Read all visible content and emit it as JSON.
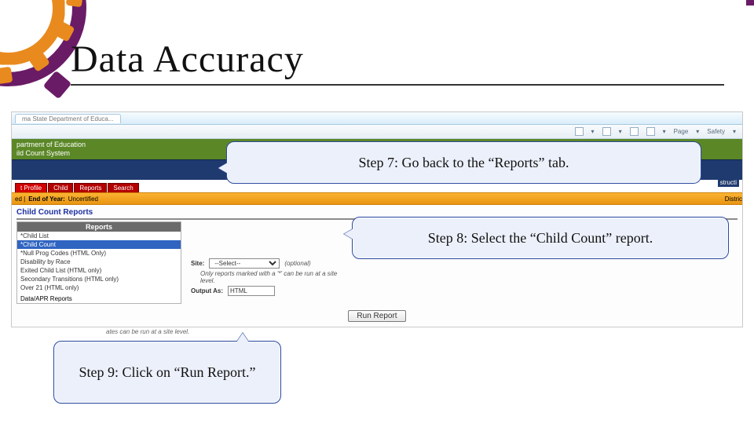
{
  "slide": {
    "title": "Data Accuracy"
  },
  "callouts": {
    "step7": "Step 7: Go back to the “Reports” tab.",
    "step8": "Step 8: Select the “Child Count” report.",
    "step9": "Step 9: Click on “Run Report.”"
  },
  "browser": {
    "tab_title": "ma State Department of Educa...",
    "toolbar": {
      "page": "Page",
      "safety": "Safety"
    }
  },
  "app_header": {
    "line1": "partment of Education",
    "line2": "ild Count System",
    "tab_instructions": "structi"
  },
  "tabs": {
    "items": [
      {
        "label": "t Profile",
        "active": true
      },
      {
        "label": "Child"
      },
      {
        "label": "Reports"
      },
      {
        "label": "Search"
      }
    ]
  },
  "orange_bar": {
    "label": "End of Year:",
    "value": "Uncertified",
    "right": "Distric"
  },
  "section_title": "Child Count Reports",
  "report_list": {
    "header": "Reports",
    "items": [
      {
        "text": "*Child List"
      },
      {
        "text": "*Child Count",
        "selected": true
      },
      {
        "text": "*Null Prog Codes (HTML Only)"
      },
      {
        "text": "Disability by Race"
      },
      {
        "text": "Exited Child List (HTML only)"
      },
      {
        "text": "Secondary Transitions (HTML only)"
      },
      {
        "text": "Over 21 (HTML only)"
      }
    ],
    "section_item": "Data/APR Reports"
  },
  "options": {
    "site_label": "Site:",
    "site_value": "--Select--",
    "optional": "(optional)",
    "note": "Only reports marked with a '*' can be run at a site level.",
    "output_label": "Output As:",
    "output_value": "HTML"
  },
  "run_button": "Run Report",
  "footer_note": "ates can be run at a site level."
}
